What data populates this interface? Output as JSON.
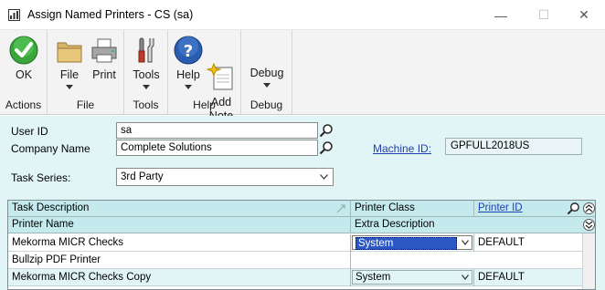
{
  "window": {
    "title": "Assign Named Printers  -  CS (sa)",
    "minimize_glyph": "—",
    "maximize_glyph": "☐",
    "close_glyph": "✕"
  },
  "ribbon": {
    "groups": [
      {
        "label": "Actions",
        "buttons": [
          {
            "label": "OK",
            "icon": "ok-check-icon"
          }
        ]
      },
      {
        "label": "File",
        "buttons": [
          {
            "label": "File",
            "icon": "folder-icon",
            "dropdown": true
          },
          {
            "label": "Print",
            "icon": "printer-icon"
          }
        ]
      },
      {
        "label": "Tools",
        "buttons": [
          {
            "label": "Tools",
            "icon": "tools-icon",
            "dropdown": true
          }
        ]
      },
      {
        "label": "Help",
        "buttons": [
          {
            "label": "Help",
            "icon": "help-icon",
            "dropdown": true
          },
          {
            "label": "Add\nNote",
            "icon": "add-note-icon"
          }
        ]
      },
      {
        "label": "Debug",
        "buttons": [
          {
            "label": "Debug",
            "icon": "",
            "dropdown": true
          }
        ]
      }
    ]
  },
  "form": {
    "user_id_label": "User ID",
    "user_id_value": "sa",
    "company_name_label": "Company Name",
    "company_name_value": "Complete Solutions",
    "machine_id_label": "Machine ID:",
    "machine_id_value": "GPFULL2018US",
    "task_series_label": "Task Series:",
    "task_series_value": "3rd Party"
  },
  "grid": {
    "headers_row1": {
      "task_description": "Task Description",
      "printer_class": "Printer Class",
      "printer_id": "Printer ID"
    },
    "headers_row2": {
      "printer_name": "Printer Name",
      "extra_description": "Extra Description"
    },
    "rows": [
      {
        "task": "Mekorma MICR Checks",
        "printer_class": "System",
        "printer_id": "DEFAULT",
        "selected": true,
        "shaded": false
      },
      {
        "task": "Bullzip PDF Printer",
        "printer_class": "",
        "printer_id": "",
        "selected": false,
        "shaded": false,
        "sub": true
      },
      {
        "task": "Mekorma MICR Checks Copy",
        "printer_class": "System",
        "printer_id": "DEFAULT",
        "selected": false,
        "shaded": true
      }
    ]
  },
  "colors": {
    "form_bg": "#e1f5f7",
    "grid_header_bg": "#c4eaee",
    "link": "#1f3fb3",
    "selection": "#2b58c5"
  }
}
